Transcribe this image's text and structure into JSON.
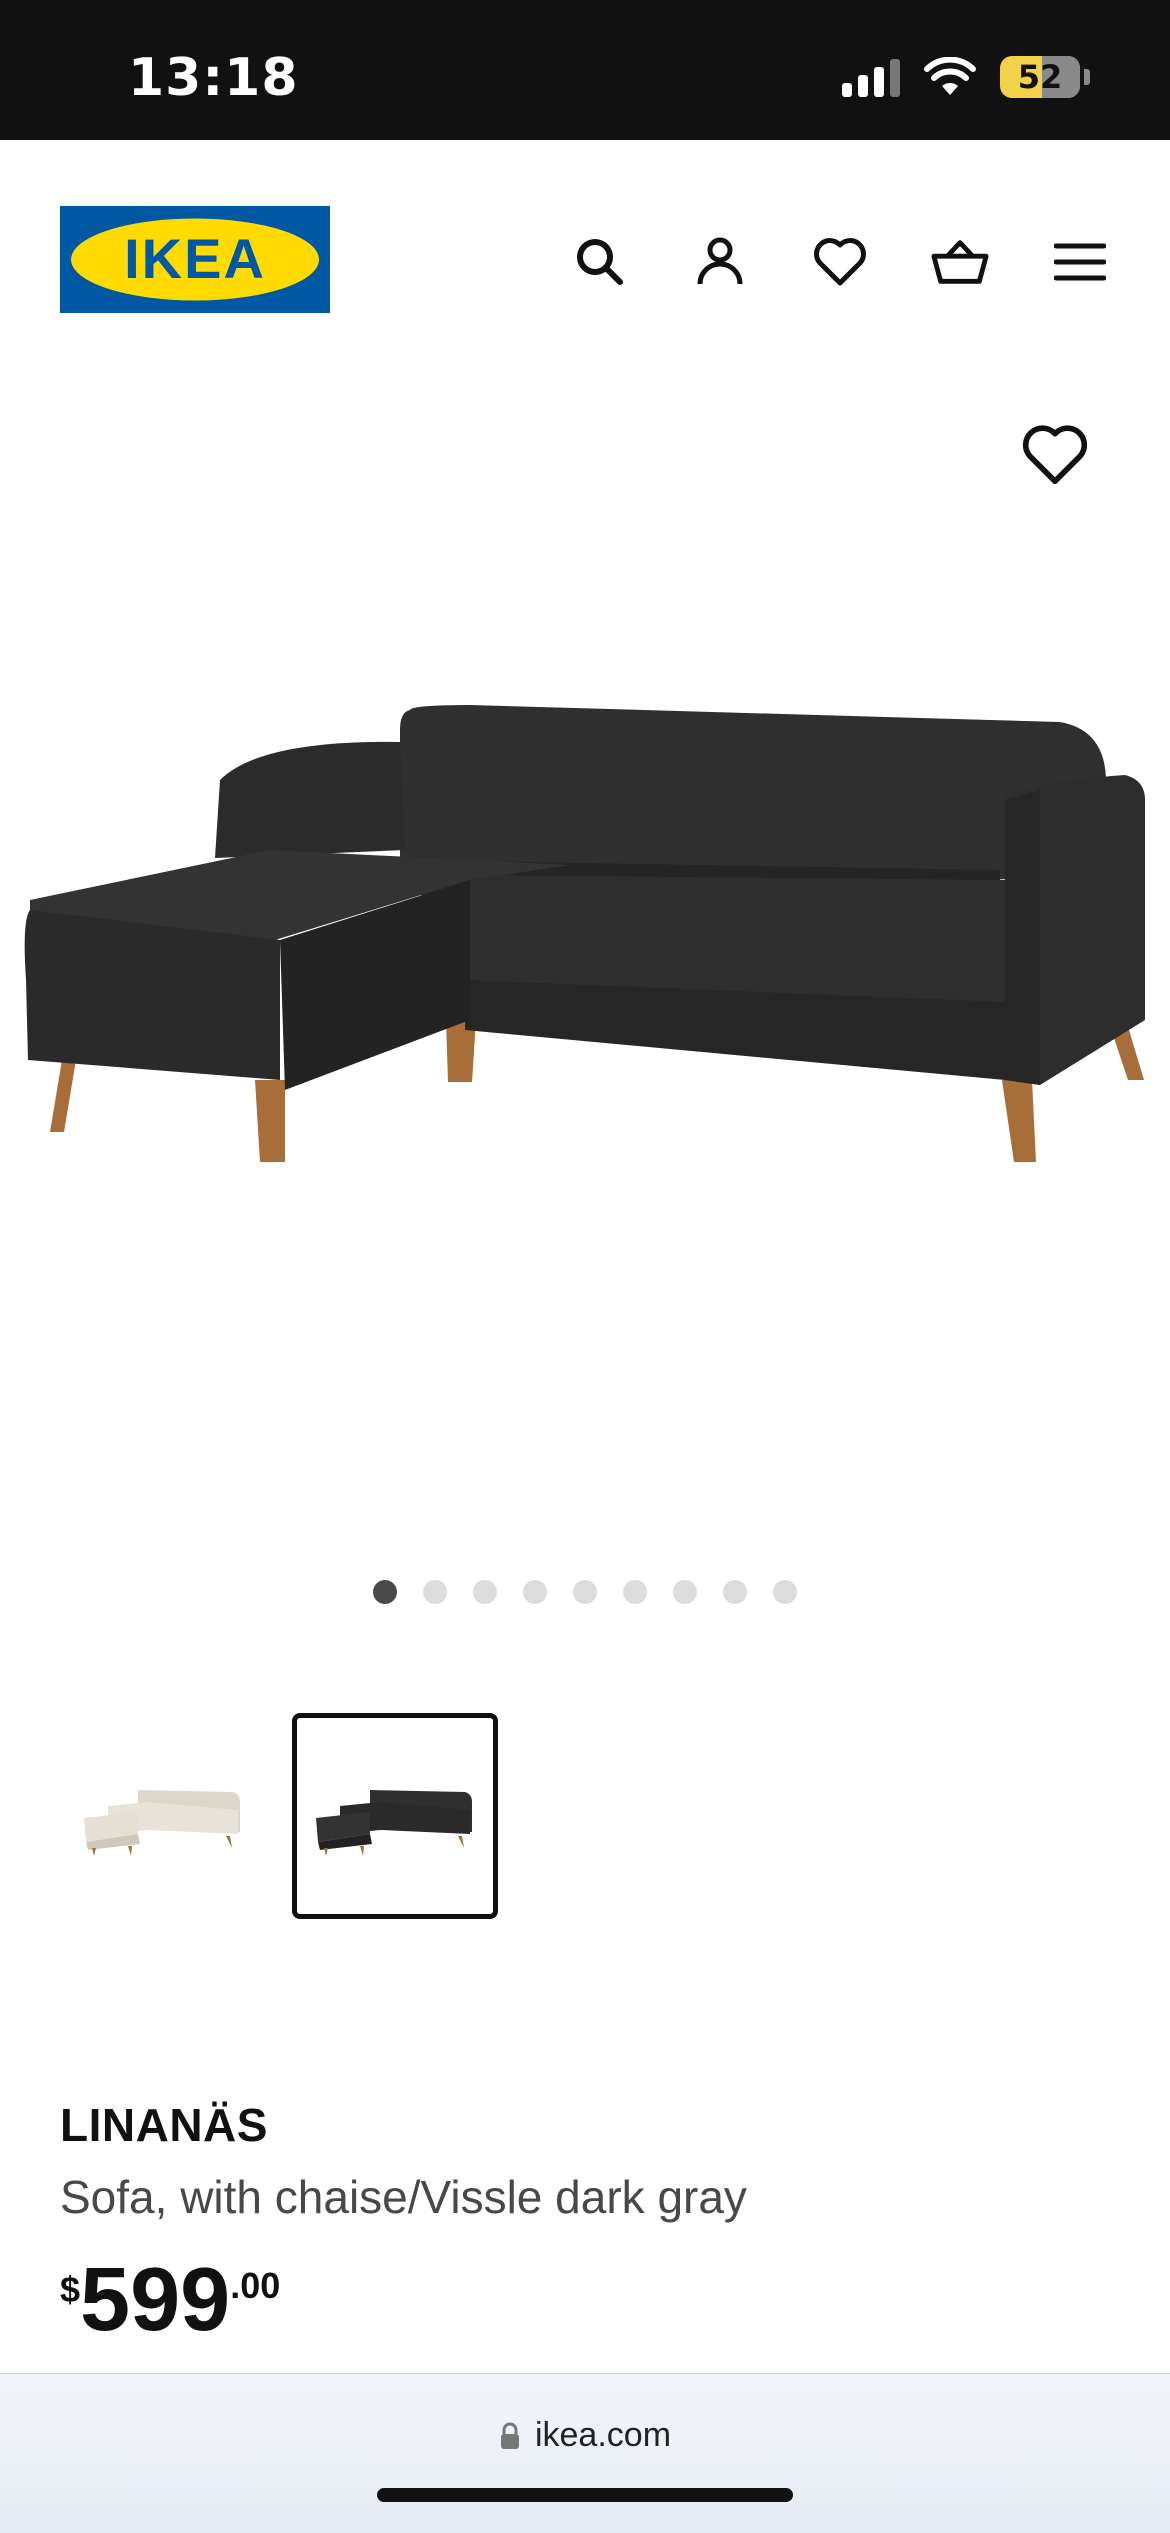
{
  "status_bar": {
    "time": "13:18",
    "battery": "52"
  },
  "header": {
    "logo_text": "IKEA",
    "brand_colors": {
      "blue": "#0058a3",
      "yellow": "#ffdb00"
    },
    "actions": [
      "search-icon",
      "account-icon",
      "heart-icon",
      "cart-icon",
      "menu-icon"
    ]
  },
  "gallery": {
    "dot_count": 9,
    "active_index": 0,
    "thumbnails": [
      {
        "variant": "beige",
        "selected": false
      },
      {
        "variant": "dark gray",
        "selected": true
      }
    ]
  },
  "product": {
    "name": "LINANÄS",
    "description": "Sofa, with chaise/Vissle dark gray",
    "price": {
      "currency": "$",
      "integer": "599",
      "decimal": ".00"
    }
  },
  "browser": {
    "url": "ikea.com"
  }
}
